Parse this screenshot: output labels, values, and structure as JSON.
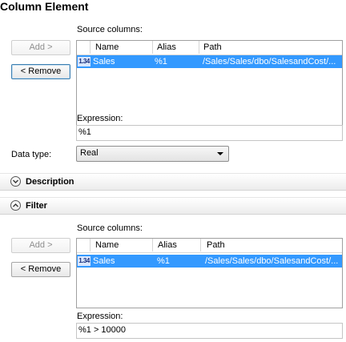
{
  "title": "Column Element",
  "column_section": {
    "source_columns_label": "Source columns:",
    "add_label": "Add >",
    "remove_label": "< Remove",
    "headers": [
      "Name",
      "Alias",
      "Path"
    ],
    "row": {
      "type_icon": "1.34",
      "name": "Sales",
      "alias": "%1",
      "path": "/Sales/Sales/dbo/SalesandCost/..."
    },
    "expression_label": "Expression:",
    "expression_value": "%1",
    "data_type_label": "Data type:",
    "data_type_value": "Real"
  },
  "description_section": {
    "label": "Description",
    "icon": "chevron-down-circle-icon",
    "expanded": false
  },
  "filter_section": {
    "label": "Filter",
    "icon": "chevron-up-circle-icon",
    "expanded": true,
    "source_columns_label": "Source columns:",
    "add_label": "Add >",
    "remove_label": "< Remove",
    "headers": [
      "Name",
      "Alias",
      "Path"
    ],
    "row": {
      "type_icon": "1.34",
      "name": "Sales",
      "alias": "%1",
      "path": "/Sales/Sales/dbo/SalesandCost/..."
    },
    "expression_label": "Expression:",
    "expression_value": "%1 > 10000"
  },
  "colors": {
    "selection": "#3399ff",
    "section_bg": "#ececec"
  }
}
